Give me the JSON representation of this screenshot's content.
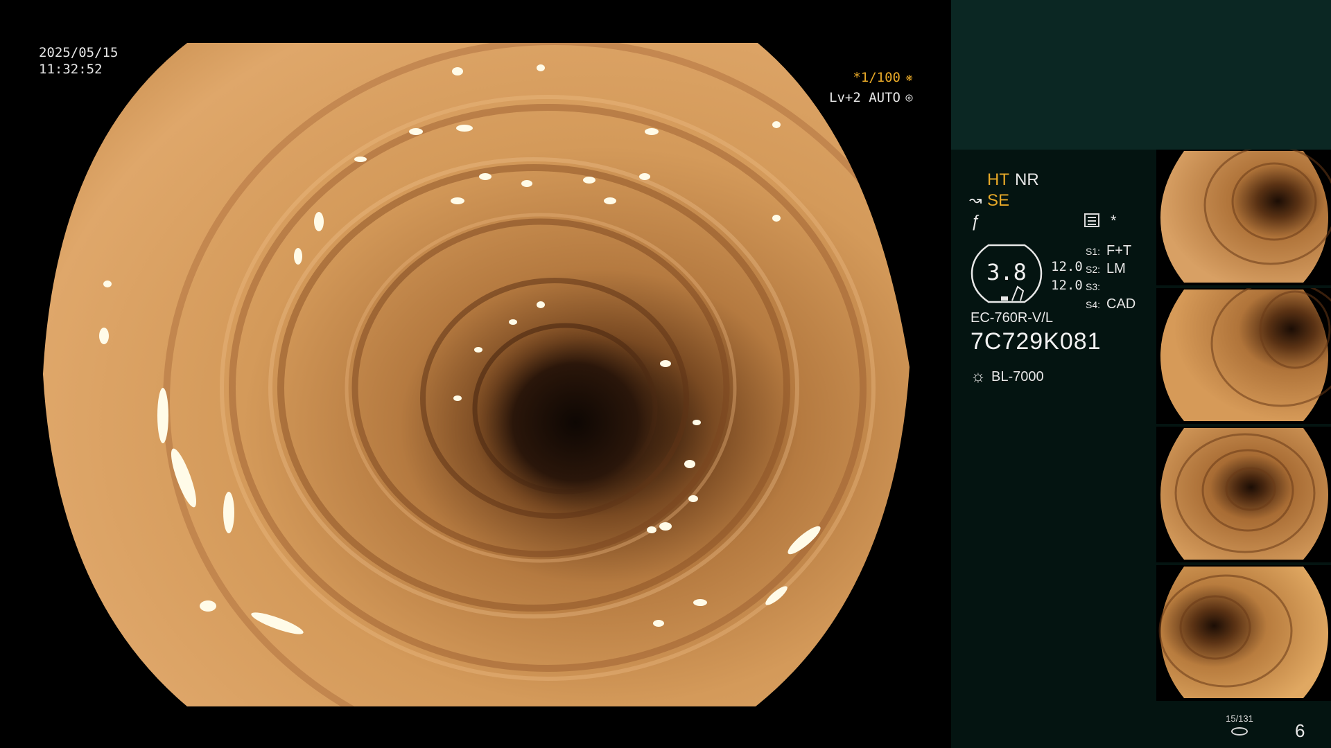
{
  "overlay": {
    "date": "2025/05/15",
    "time": "11:32:52",
    "shutter_speed": "*1/100",
    "iris_mode": "Lv+2 AUTO",
    "shutter_icon": "aperture-icon",
    "iris_icon": "iris-icon"
  },
  "image_modes": {
    "ht": "HT",
    "nr": "NR",
    "se": "SE",
    "ht_color": "#e8a928",
    "se_color": "#e8a928",
    "se_icon": "signal-enhance-icon",
    "freeze_icon": "function-icon",
    "memory_icon": "memory-list-icon",
    "star": "*"
  },
  "zoom": {
    "value": "3.8",
    "upper": "12.0",
    "lower": "12.0"
  },
  "switches": [
    {
      "key": "S1:",
      "value": "F+T"
    },
    {
      "key": "S2:",
      "value": "LM"
    },
    {
      "key": "S3:",
      "value": ""
    },
    {
      "key": "S4:",
      "value": "CAD"
    }
  ],
  "scope": {
    "model": "EC-760R-V/L",
    "serial": "7C729K081"
  },
  "light_source": {
    "icon": "lamp-icon",
    "model": "BL-7000"
  },
  "capture": {
    "counter": "15/131",
    "page": "6"
  },
  "colors": {
    "panel_bg": "#041411",
    "panel_top_bg": "#0b2723",
    "accent": "#e8a928",
    "mucosa": "#c58a4a"
  }
}
